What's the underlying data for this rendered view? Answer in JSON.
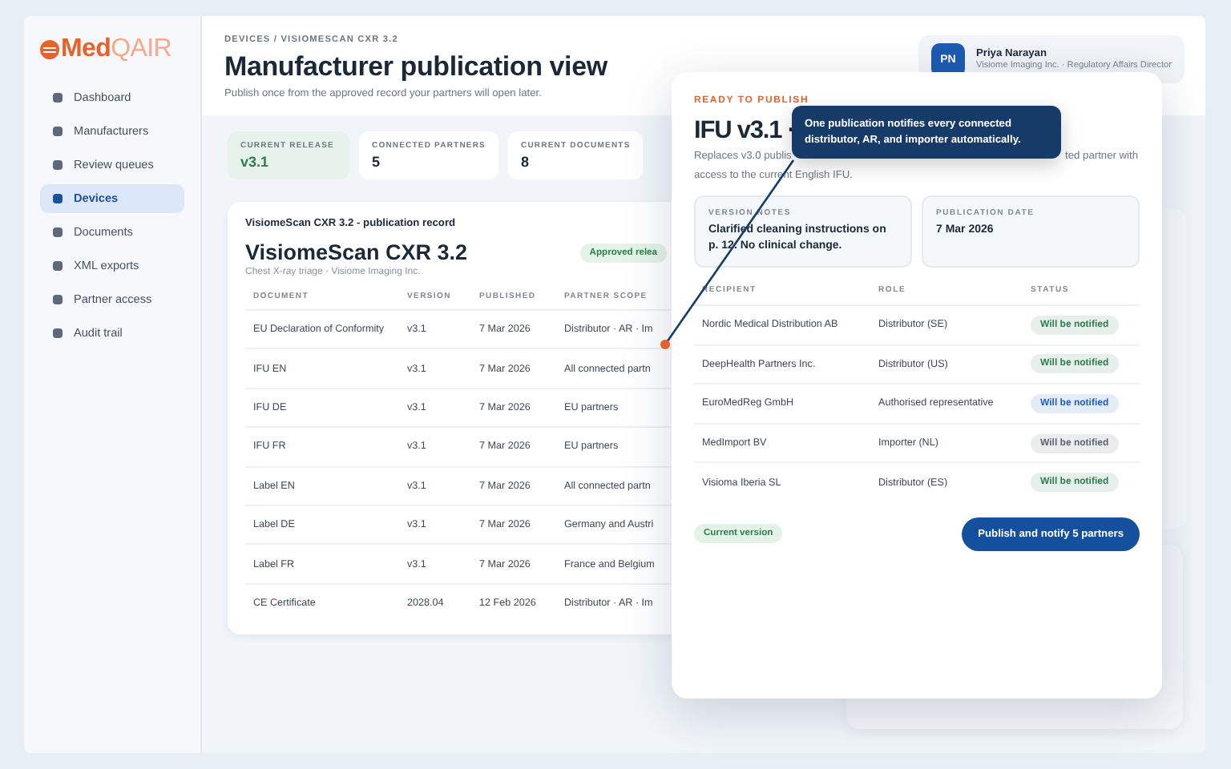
{
  "logo": {
    "name": "Med",
    "suffix": "QAIR"
  },
  "sidebar": {
    "items": [
      {
        "label": "Dashboard",
        "selected": false
      },
      {
        "label": "Manufacturers",
        "selected": false
      },
      {
        "label": "Review queues",
        "selected": false
      },
      {
        "label": "Devices",
        "selected": true
      },
      {
        "label": "Documents",
        "selected": false
      },
      {
        "label": "XML exports",
        "selected": false
      },
      {
        "label": "Partner access",
        "selected": false
      },
      {
        "label": "Audit trail",
        "selected": false
      }
    ]
  },
  "header": {
    "breadcrumb": "DEVICES / VISIOMESCAN CXR 3.2",
    "title": "Manufacturer publication view",
    "subtitle": "Publish once from the approved record your partners will open later."
  },
  "user": {
    "initials": "PN",
    "name": "Priya Narayan",
    "role": "Visiome Imaging Inc. · Regulatory Affairs Director"
  },
  "stats": [
    {
      "label": "CURRENT RELEASE",
      "value": "v3.1",
      "highlight": true
    },
    {
      "label": "CONNECTED PARTNERS",
      "value": "5",
      "highlight": false
    },
    {
      "label": "CURRENT DOCUMENTS",
      "value": "8",
      "highlight": false
    }
  ],
  "record": {
    "heading": "VisiomeScan CXR 3.2 - publication record",
    "title": "VisiomeScan CXR 3.2",
    "subtitle": "Chest X-ray triage · Visiome Imaging Inc.",
    "badge": "Approved relea",
    "columns": [
      "DOCUMENT",
      "VERSION",
      "PUBLISHED",
      "PARTNER SCOPE"
    ],
    "rows": [
      [
        "EU Declaration of Conformity",
        "v3.1",
        "7 Mar 2026",
        "Distributor · AR · Im"
      ],
      [
        "IFU EN",
        "v3.1",
        "7 Mar 2026",
        "All connected partn"
      ],
      [
        "IFU DE",
        "v3.1",
        "7 Mar 2026",
        "EU partners"
      ],
      [
        "IFU FR",
        "v3.1",
        "7 Mar 2026",
        "EU partners"
      ],
      [
        "Label EN",
        "v3.1",
        "7 Mar 2026",
        "All connected partn"
      ],
      [
        "Label DE",
        "v3.1",
        "7 Mar 2026",
        "Germany and Austri"
      ],
      [
        "Label FR",
        "v3.1",
        "7 Mar 2026",
        "France and Belgium"
      ],
      [
        "CE Certificate",
        "2028.04",
        "12 Feb 2026",
        "Distributor · AR · Im"
      ]
    ]
  },
  "modal": {
    "eyebrow": "READY TO PUBLISH",
    "title": "IFU v3.1 ·",
    "subtitle_parts": [
      "Replaces v3.0 publis",
      "ted partner with",
      "access to the current English IFU."
    ],
    "notes": [
      {
        "label": "VERSION NOTES",
        "value": "Clarified cleaning instructions on p. 12. No clinical change."
      },
      {
        "label": "PUBLICATION DATE",
        "value": "7 Mar 2026"
      }
    ],
    "columns": [
      "RECIPIENT",
      "ROLE",
      "STATUS"
    ],
    "recipients": [
      {
        "name": "Nordic Medical Distribution AB",
        "role": "Distributor (SE)",
        "status": "Will be notified",
        "color": "#2e7d4f"
      },
      {
        "name": "DeepHealth Partners Inc.",
        "role": "Distributor (US)",
        "status": "Will be notified",
        "color": "#2e7d4f"
      },
      {
        "name": "EuroMedReg GmbH",
        "role": "Authorised representative",
        "status": "Will be notified",
        "color": "#1f5fbf"
      },
      {
        "name": "MedImport BV",
        "role": "Importer (NL)",
        "status": "Will be notified",
        "color": "#5b6576"
      },
      {
        "name": "Visioma Iberia SL",
        "role": "Distributor (ES)",
        "status": "Will be notified",
        "color": "#2e7d4f"
      }
    ],
    "version_badge": "Current version",
    "button": "Publish and notify 5 partners"
  },
  "tooltip": {
    "text": "One publication notifies every connected distributor, AR, and importer automatically."
  }
}
